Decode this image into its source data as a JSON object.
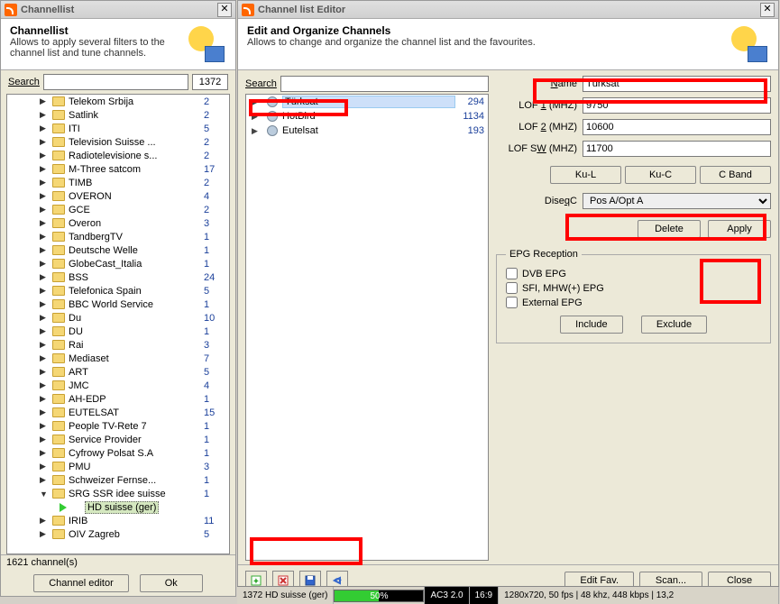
{
  "left": {
    "title": "Channellist",
    "descTitle": "Channellist",
    "desc": "Allows to apply several filters to the channel list and tune channels.",
    "searchLabel": "Search",
    "count": "1372",
    "channels": [
      [
        "Telekom Srbija",
        "2"
      ],
      [
        "Satlink",
        "2"
      ],
      [
        "ITI",
        "5"
      ],
      [
        "Television Suisse ...",
        "2"
      ],
      [
        "Radiotelevisione s...",
        "2"
      ],
      [
        "M-Three satcom",
        "17"
      ],
      [
        "TIMB",
        "2"
      ],
      [
        "OVERON",
        "4"
      ],
      [
        "GCE",
        "2"
      ],
      [
        "Overon",
        "3"
      ],
      [
        "TandbergTV",
        "1"
      ],
      [
        "Deutsche Welle",
        "1"
      ],
      [
        "GlobeCast_Italia",
        "1"
      ],
      [
        "BSS",
        "24"
      ],
      [
        "Telefonica Spain",
        "5"
      ],
      [
        "BBC World Service",
        "1"
      ],
      [
        "Du",
        "10"
      ],
      [
        "DU",
        "1"
      ],
      [
        "Rai",
        "3"
      ],
      [
        "Mediaset",
        "7"
      ],
      [
        "ART",
        "5"
      ],
      [
        "JMC",
        "4"
      ],
      [
        "AH-EDP",
        "1"
      ],
      [
        "EUTELSAT",
        "15"
      ],
      [
        "People TV-Rete 7",
        "1"
      ],
      [
        "Service Provider",
        "1"
      ],
      [
        "Cyfrowy Polsat S.A",
        "1"
      ],
      [
        "PMU",
        "3"
      ],
      [
        "Schweizer Fernse...",
        "1"
      ],
      [
        "SRG SSR idee suisse",
        "1"
      ]
    ],
    "selected": "HD suisse (ger)",
    "afterSelected": [
      [
        "IRIB",
        "11"
      ],
      [
        "OIV Zagreb",
        "5"
      ]
    ],
    "status": "1621 channel(s)",
    "btnEditor": "Channel editor",
    "btnOk": "Ok"
  },
  "right": {
    "title": "Channel list Editor",
    "descTitle": "Edit and Organize Channels",
    "desc": "Allows to change and organize the channel list and the favourites.",
    "searchLabel": "Search",
    "sats": [
      [
        "Türksat",
        "294"
      ],
      [
        "HotBird",
        "1134"
      ],
      [
        "Eutelsat",
        "193"
      ]
    ],
    "nameLabel": "Name",
    "nameVal": "Türksat",
    "lof1Label": "LOF 1 (MHZ)",
    "lof1Val": "9750",
    "lof2Label": "LOF 2 (MHZ)",
    "lof2Val": "10600",
    "lofswLabel": "LOF SW (MHZ)",
    "lofswVal": "11700",
    "bandKuL": "Ku-L",
    "bandKuC": "Ku-C",
    "bandC": "C Band",
    "diseqcLabel": "DiseqC",
    "diseqcVal": "Pos A/Opt A",
    "delete": "Delete",
    "apply": "Apply",
    "epgLegend": "EPG Reception",
    "epgDvb": "DVB EPG",
    "epgSfi": "SFI, MHW(+) EPG",
    "epgExt": "External EPG",
    "include": "Include",
    "exclude": "Exclude",
    "editFav": "Edit Fav.",
    "scan": "Scan...",
    "close": "Close"
  },
  "status2": {
    "name": "1372 HD suisse (ger)",
    "pct": "50%",
    "ac3": "AC3 2.0",
    "aspect": "16:9",
    "info": "1280x720, 50 fps | 48 khz, 448 kbps | 13,2"
  }
}
